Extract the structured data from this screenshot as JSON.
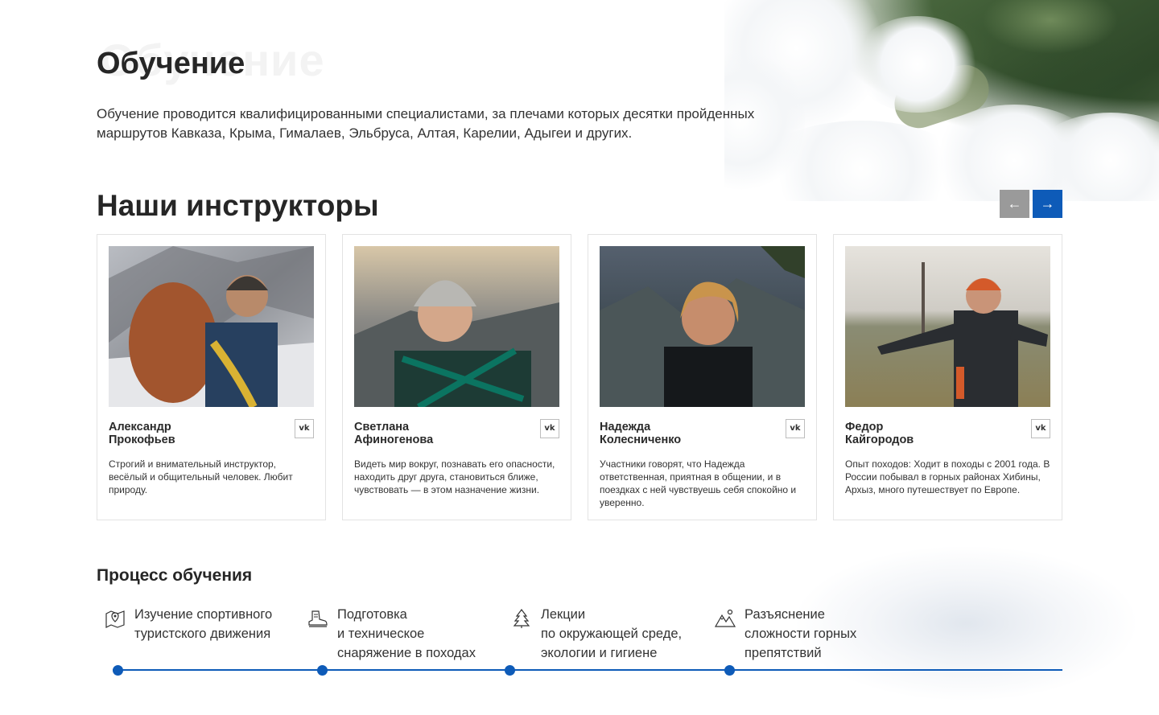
{
  "education": {
    "ghost_title": "Обучение",
    "title": "Обучение",
    "intro": "Обучение проводится квалифицированными специалистами, за плечами которых десятки пройденных маршрутов Кавказа, Крыма, Гималаев, Эльбруса, Алтая, Карелии, Адыгеи и других."
  },
  "instructors": {
    "title": "Наши инструкторы",
    "prev_label": "←",
    "next_label": "→",
    "vk_label": "vk",
    "items": [
      {
        "name": "Александр\nПрокофьев",
        "desc": "Строгий и внимательный инструктор, весёлый и общительный человек. Любит природу."
      },
      {
        "name": "Светлана\nАфиногенова",
        "desc": "Видеть мир вокруг, познавать его опасности, находить друг друга, становиться ближе, чувствовать — в этом назначение жизни."
      },
      {
        "name": "Надежда\nКолесниченко",
        "desc": "Участники говорят, что Надежда ответственная, приятная в общении, и в поездках с ней чувствуешь себя спокойно и уверенно."
      },
      {
        "name": "Федор\nКайгородов",
        "desc": "Опыт походов: Ходит в походы с 2001 года. В России побывал в горных районах Хибины, Архыз, много путешествует по Европе."
      }
    ]
  },
  "process": {
    "title": "Процесс обучения",
    "steps": [
      {
        "icon": "map-pin-icon",
        "text": "Изучение спортивного\nтуристского движения"
      },
      {
        "icon": "hiking-boot-icon",
        "text": "Подготовка\nи техническое\nснаряжение в походах"
      },
      {
        "icon": "pine-tree-icon",
        "text": "Лекции\nпо окружающей среде,\nэкологии и гигиене"
      },
      {
        "icon": "mountains-icon",
        "text": "Разъяснение\nсложности горных\nпрепятствий"
      }
    ]
  },
  "colors": {
    "accent": "#0e5bb8",
    "button_disabled": "#9a9a9a"
  }
}
